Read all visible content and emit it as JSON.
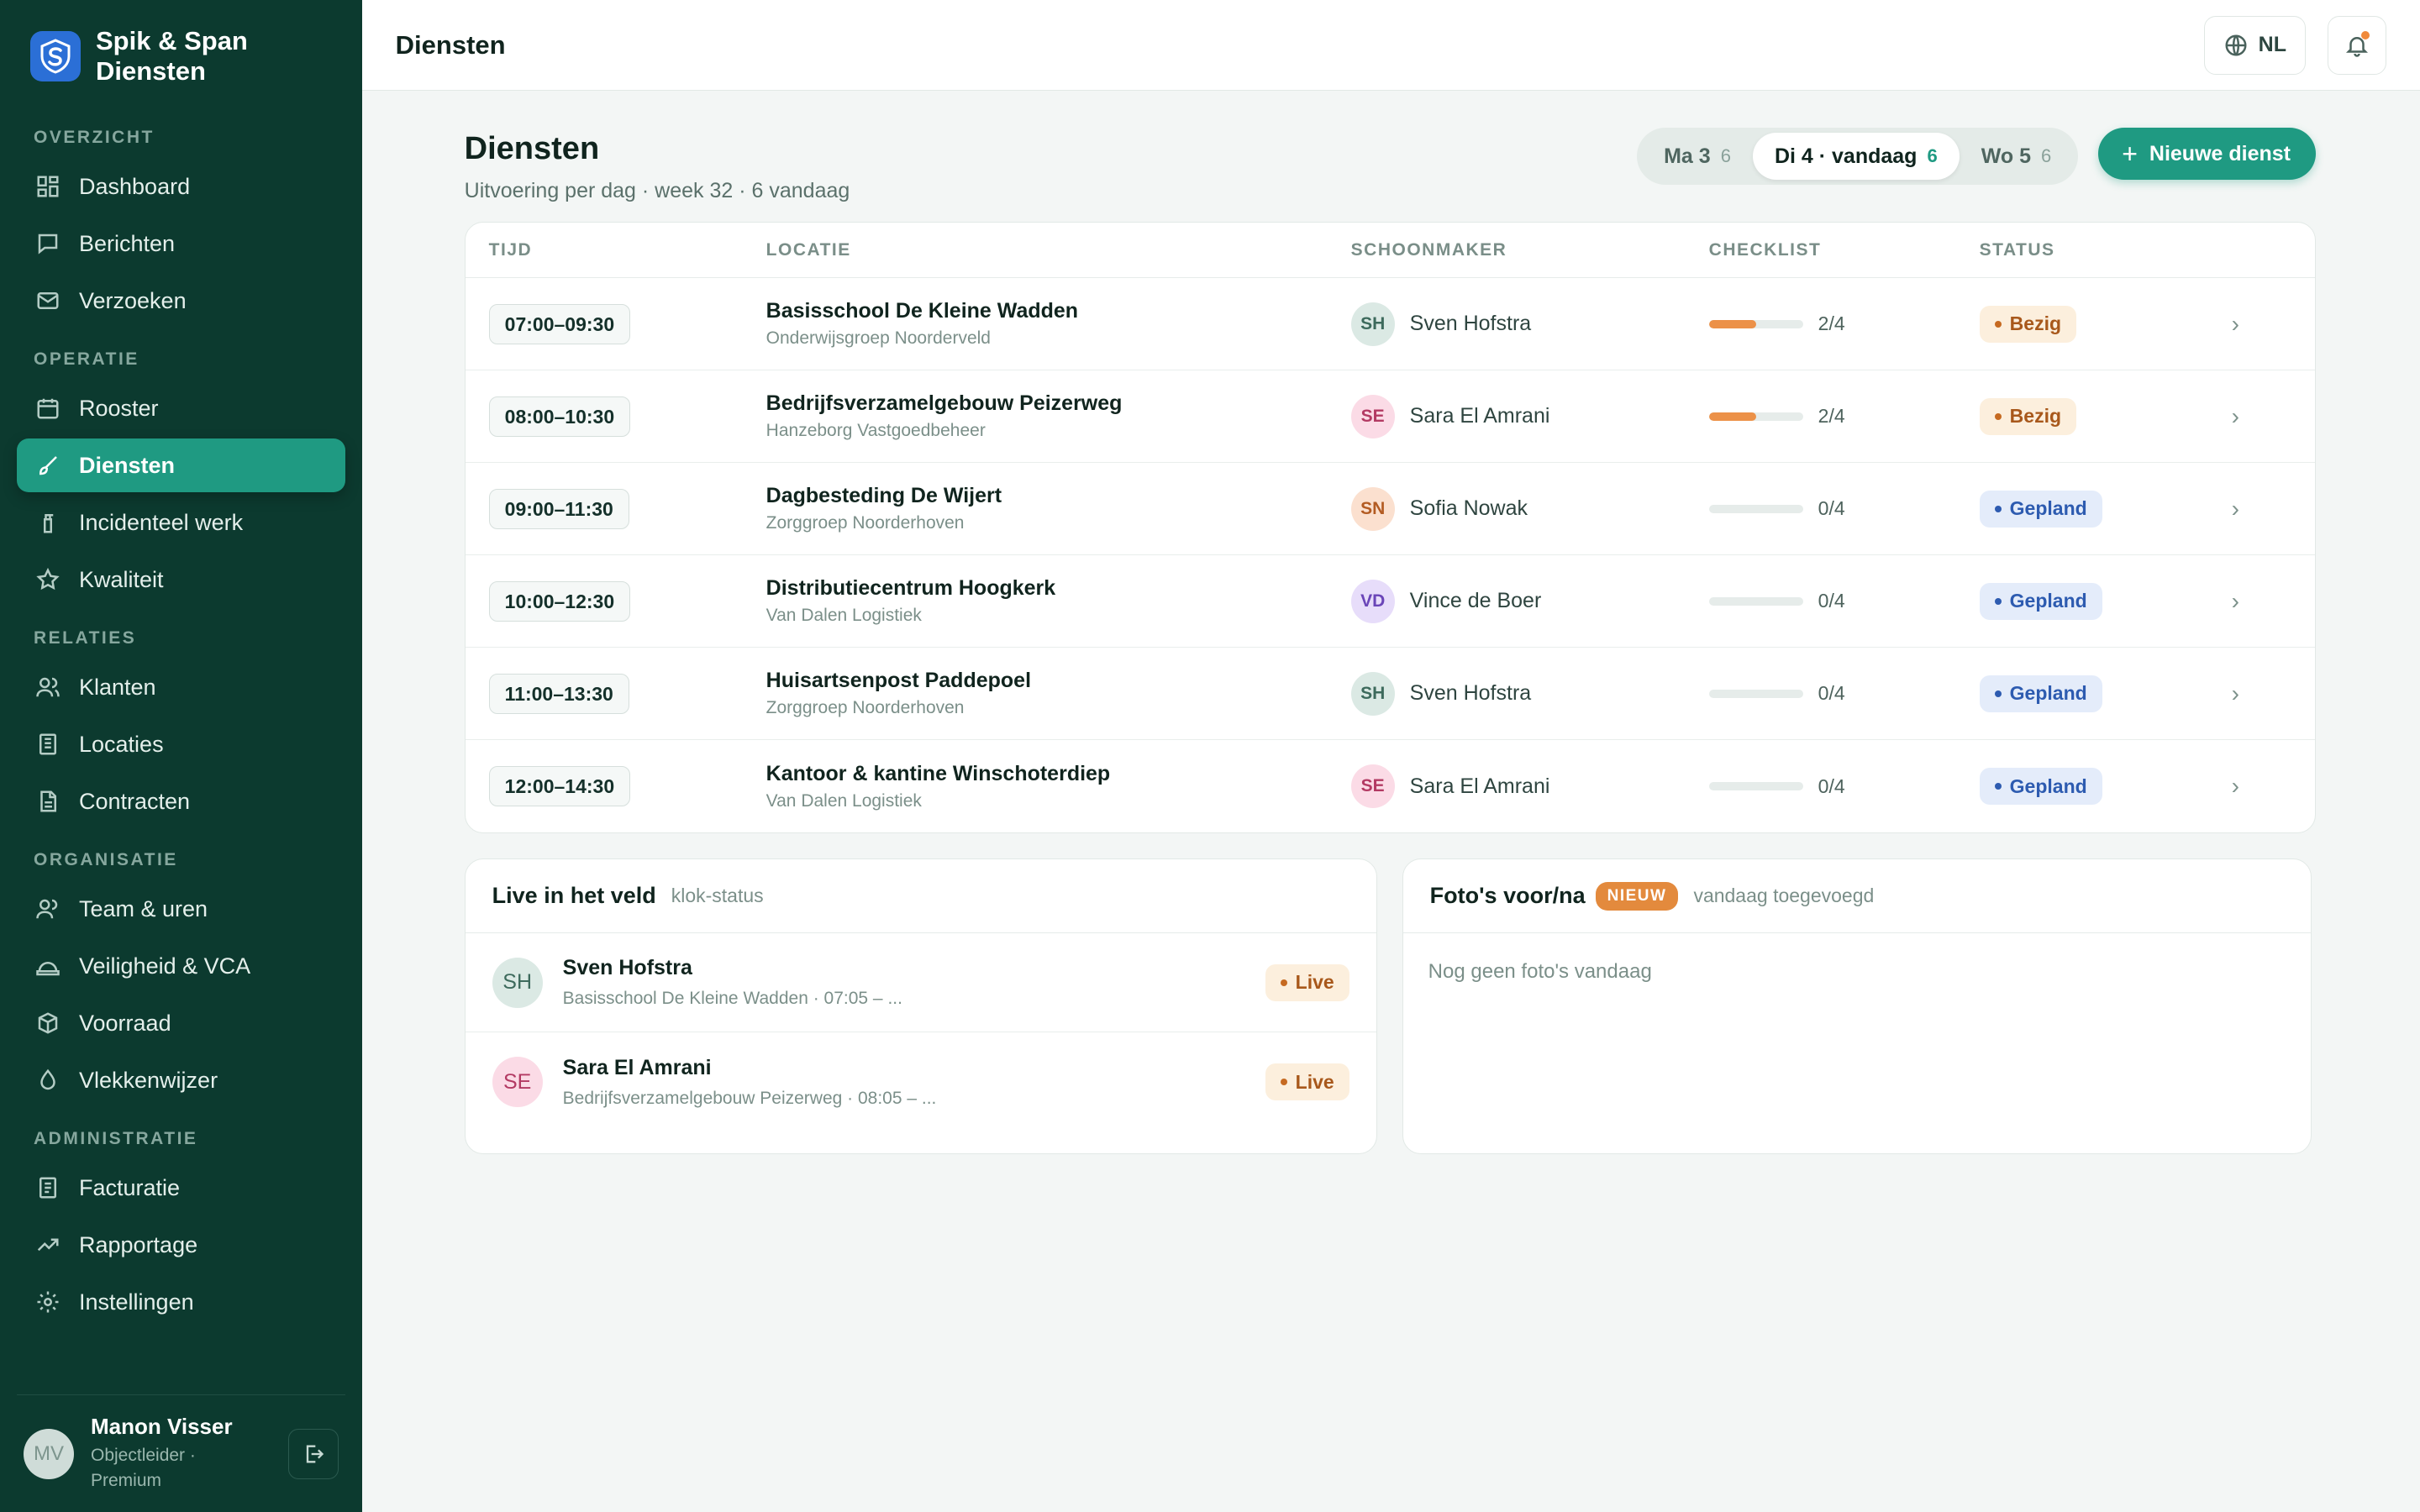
{
  "brand": {
    "line1": "Spik & Span",
    "line2": "Diensten",
    "color": "#2b6fd6"
  },
  "nav": {
    "sections": [
      {
        "title": "OVERZICHT",
        "items": [
          {
            "label": "Dashboard",
            "icon": "dashboard-icon"
          },
          {
            "label": "Berichten",
            "icon": "chat-icon"
          },
          {
            "label": "Verzoeken",
            "icon": "mail-icon"
          }
        ]
      },
      {
        "title": "OPERATIE",
        "items": [
          {
            "label": "Rooster",
            "icon": "calendar-icon"
          },
          {
            "label": "Diensten",
            "icon": "brush-icon",
            "active": true
          },
          {
            "label": "Incidenteel werk",
            "icon": "spray-bottle-icon"
          },
          {
            "label": "Kwaliteit",
            "icon": "star-icon"
          }
        ]
      },
      {
        "title": "RELATIES",
        "items": [
          {
            "label": "Klanten",
            "icon": "users-icon"
          },
          {
            "label": "Locaties",
            "icon": "building-icon"
          },
          {
            "label": "Contracten",
            "icon": "document-icon"
          }
        ]
      },
      {
        "title": "ORGANISATIE",
        "items": [
          {
            "label": "Team & uren",
            "icon": "team-icon"
          },
          {
            "label": "Veiligheid & VCA",
            "icon": "helmet-icon"
          },
          {
            "label": "Voorraad",
            "icon": "box-icon"
          },
          {
            "label": "Vlekkenwijzer",
            "icon": "drop-icon"
          }
        ]
      },
      {
        "title": "ADMINISTRATIE",
        "items": [
          {
            "label": "Facturatie",
            "icon": "invoice-icon"
          },
          {
            "label": "Rapportage",
            "icon": "trend-icon"
          },
          {
            "label": "Instellingen",
            "icon": "gear-icon"
          }
        ]
      }
    ]
  },
  "user": {
    "initials": "MV",
    "name": "Manon Visser",
    "role": "Objectleider · Premium"
  },
  "topbar": {
    "title": "Diensten",
    "lang": "NL"
  },
  "page": {
    "title": "Diensten",
    "subtitle": "Uitvoering per dag · week 32 · 6 vandaag",
    "new_button": "Nieuwe dienst",
    "day_tabs": [
      {
        "label": "Ma 3",
        "count": "6",
        "active": false
      },
      {
        "label": "Di 4 · vandaag",
        "count": "6",
        "active": true
      },
      {
        "label": "Wo 5",
        "count": "6",
        "active": false
      }
    ]
  },
  "table": {
    "headers": {
      "time": "TIJD",
      "location": "LOCATIE",
      "cleaner": "SCHOONMAKER",
      "checklist": "CHECKLIST",
      "status": "STATUS"
    },
    "rows": [
      {
        "time": "07:00–09:30",
        "location": "Basisschool De Kleine Wadden",
        "org": "Onderwijsgroep Noorderveld",
        "initials": "SH",
        "cleaner": "Sven Hofstra",
        "av_bg": "#dbe9e4",
        "av_fg": "#3d6a5c",
        "checklist": "2/4",
        "progress": 0.5,
        "status": "Bezig",
        "status_kind": "busy"
      },
      {
        "time": "08:00–10:30",
        "location": "Bedrijfsverzamelgebouw Peizerweg",
        "org": "Hanzeborg Vastgoedbeheer",
        "initials": "SE",
        "cleaner": "Sara El Amrani",
        "av_bg": "#fbdbe6",
        "av_fg": "#b33a63",
        "checklist": "2/4",
        "progress": 0.5,
        "status": "Bezig",
        "status_kind": "busy"
      },
      {
        "time": "09:00–11:30",
        "location": "Dagbesteding De Wijert",
        "org": "Zorggroep Noorderhoven",
        "initials": "SN",
        "cleaner": "Sofia Nowak",
        "av_bg": "#fbe0cf",
        "av_fg": "#b35b22",
        "checklist": "0/4",
        "progress": 0,
        "status": "Gepland",
        "status_kind": "plan"
      },
      {
        "time": "10:00–12:30",
        "location": "Distributiecentrum Hoogkerk",
        "org": "Van Dalen Logistiek",
        "initials": "VD",
        "cleaner": "Vince de Boer",
        "av_bg": "#e7ddfa",
        "av_fg": "#6a45b8",
        "checklist": "0/4",
        "progress": 0,
        "status": "Gepland",
        "status_kind": "plan"
      },
      {
        "time": "11:00–13:30",
        "location": "Huisartsenpost Paddepoel",
        "org": "Zorggroep Noorderhoven",
        "initials": "SH",
        "cleaner": "Sven Hofstra",
        "av_bg": "#dbe9e4",
        "av_fg": "#3d6a5c",
        "checklist": "0/4",
        "progress": 0,
        "status": "Gepland",
        "status_kind": "plan"
      },
      {
        "time": "12:00–14:30",
        "location": "Kantoor & kantine Winschoterdiep",
        "org": "Van Dalen Logistiek",
        "initials": "SE",
        "cleaner": "Sara El Amrani",
        "av_bg": "#fbdbe6",
        "av_fg": "#b33a63",
        "checklist": "0/4",
        "progress": 0,
        "status": "Gepland",
        "status_kind": "plan"
      }
    ]
  },
  "live": {
    "title": "Live in het veld",
    "subtitle": "klok-status",
    "rows": [
      {
        "initials": "SH",
        "name": "Sven Hofstra",
        "detail": "Basisschool De Kleine Wadden · 07:05 – ...",
        "badge": "Live",
        "av_bg": "#dbe9e4",
        "av_fg": "#3d6a5c"
      },
      {
        "initials": "SE",
        "name": "Sara El Amrani",
        "detail": "Bedrijfsverzamelgebouw Peizerweg · 08:05 – ...",
        "badge": "Live",
        "av_bg": "#fbdbe6",
        "av_fg": "#b33a63"
      }
    ]
  },
  "photos": {
    "title": "Foto's voor/na",
    "tag": "NIEUW",
    "subtitle": "vandaag toegevoegd",
    "empty": "Nog geen foto's vandaag"
  },
  "colors": {
    "accent": "#1f9a82",
    "sidebar": "#0c3a2f",
    "busy": "#c66a21",
    "planned": "#2d5bb0"
  }
}
